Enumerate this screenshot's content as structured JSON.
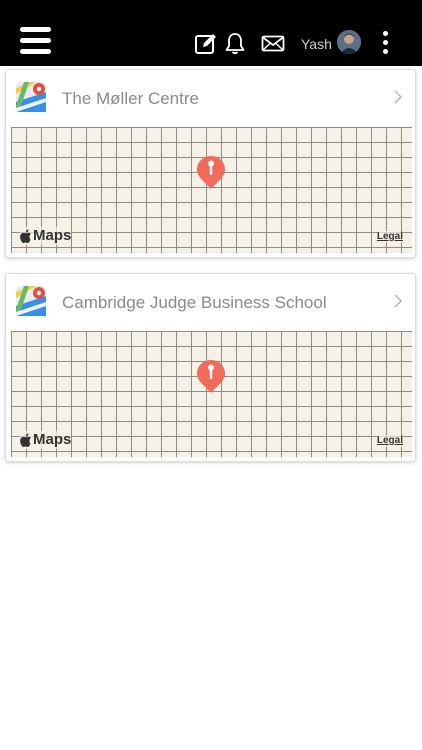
{
  "header": {
    "username": "Yash",
    "icons": [
      "menu-icon",
      "compose-icon",
      "bell-icon",
      "mail-icon",
      "avatar",
      "more-vertical-icon"
    ]
  },
  "locations": [
    {
      "name": "The Møller Centre",
      "brand": "Maps",
      "legal": "Legal"
    },
    {
      "name": "Cambridge Judge Business School",
      "brand": "Maps",
      "legal": "Legal"
    }
  ],
  "colors": {
    "topbar": "#000000",
    "pin": "#f26a5a",
    "map_background": "#f6f1e7",
    "map_grid": "#8e8b86",
    "title_text": "#8a8a8a"
  }
}
